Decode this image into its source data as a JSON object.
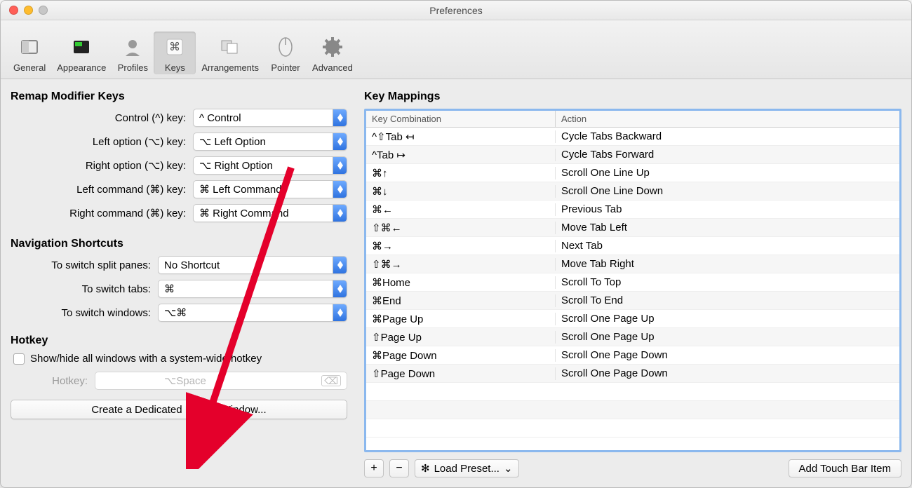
{
  "window": {
    "title": "Preferences"
  },
  "toolbar": {
    "items": [
      {
        "label": "General"
      },
      {
        "label": "Appearance"
      },
      {
        "label": "Profiles"
      },
      {
        "label": "Keys"
      },
      {
        "label": "Arrangements"
      },
      {
        "label": "Pointer"
      },
      {
        "label": "Advanced"
      }
    ]
  },
  "left": {
    "remap_title": "Remap Modifier Keys",
    "remap": [
      {
        "label": "Control (^) key:",
        "value": "^ Control"
      },
      {
        "label": "Left option (⌥) key:",
        "value": "⌥ Left Option"
      },
      {
        "label": "Right option (⌥) key:",
        "value": "⌥ Right Option"
      },
      {
        "label": "Left command (⌘) key:",
        "value": "⌘ Left Command"
      },
      {
        "label": "Right command (⌘) key:",
        "value": "⌘ Right Command"
      }
    ],
    "nav_title": "Navigation Shortcuts",
    "nav": [
      {
        "label": "To switch split panes:",
        "value": "No Shortcut"
      },
      {
        "label": "To switch tabs:",
        "value": "⌘"
      },
      {
        "label": "To switch windows:",
        "value": "⌥⌘"
      }
    ],
    "hotkey_title": "Hotkey",
    "hotkey_checkbox": "Show/hide all windows with a system-wide hotkey",
    "hotkey_label": "Hotkey:",
    "hotkey_value": "⌥Space",
    "dedicated_button": "Create a Dedicated Hotkey Window..."
  },
  "right": {
    "title": "Key Mappings",
    "col1": "Key Combination",
    "col2": "Action",
    "rows": [
      {
        "key": "^⇧Tab ↤",
        "action": "Cycle Tabs Backward"
      },
      {
        "key": "^Tab ↦",
        "action": "Cycle Tabs Forward"
      },
      {
        "key": "⌘↑",
        "action": "Scroll One Line Up"
      },
      {
        "key": "⌘↓",
        "action": "Scroll One Line Down"
      },
      {
        "key": "⌘←",
        "action": "Previous Tab"
      },
      {
        "key": "⇧⌘←",
        "action": "Move Tab Left"
      },
      {
        "key": "⌘→",
        "action": "Next Tab"
      },
      {
        "key": "⇧⌘→",
        "action": "Move Tab Right"
      },
      {
        "key": "⌘Home",
        "action": "Scroll To Top"
      },
      {
        "key": "⌘End",
        "action": "Scroll To End"
      },
      {
        "key": "⌘Page Up",
        "action": "Scroll One Page Up"
      },
      {
        "key": "⇧Page Up",
        "action": "Scroll One Page Up"
      },
      {
        "key": "⌘Page Down",
        "action": "Scroll One Page Down"
      },
      {
        "key": "⇧Page Down",
        "action": "Scroll One Page Down"
      }
    ],
    "add": "+",
    "remove": "−",
    "preset": "Load Preset...",
    "touchbar": "Add Touch Bar Item"
  }
}
